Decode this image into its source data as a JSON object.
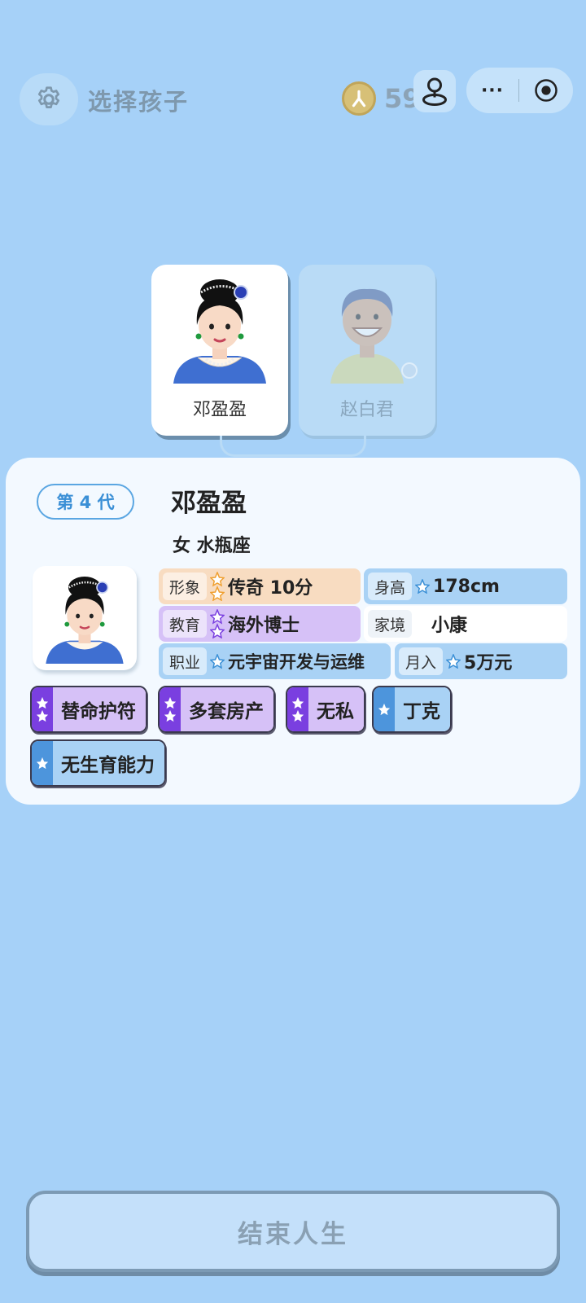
{
  "header": {
    "title": "选择孩子",
    "coin_count": "59",
    "more_label": "···"
  },
  "characters": [
    {
      "name": "邓盈盈",
      "selected": true
    },
    {
      "name": "赵白君",
      "selected": false
    }
  ],
  "profile": {
    "generation": "第 4 代",
    "name": "邓盈盈",
    "sub": "女 水瓶座",
    "attributes": {
      "image": {
        "label": "形象",
        "value": "传奇 10分"
      },
      "height": {
        "label": "身高",
        "value": "178cm"
      },
      "education": {
        "label": "教育",
        "value": "海外博士"
      },
      "family": {
        "label": "家境",
        "value": "小康"
      },
      "job": {
        "label": "职业",
        "value": "元宇宙开发与运维"
      },
      "income": {
        "label": "月入",
        "value": "5万元"
      }
    },
    "tags": [
      "替命护符",
      "多套房产",
      "无私",
      "丁克",
      "无生育能力"
    ]
  },
  "end_button": "结束人生",
  "colors": {
    "background": "#a6d1f8",
    "purple_tier": "#d6c1f7",
    "blue_tier": "#a9d2f5",
    "orange_tier": "#f8dcc1"
  }
}
